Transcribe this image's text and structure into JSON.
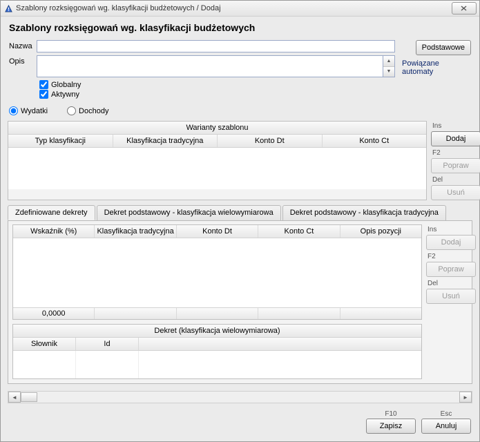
{
  "window": {
    "title": "Szablony rozksięgowań wg. klasyfikacji budżetowych / Dodaj"
  },
  "header": {
    "title": "Szablony rozksięgowań wg. klasyfikacji budżetowych"
  },
  "form": {
    "name_label": "Nazwa",
    "name_value": "",
    "desc_label": "Opis",
    "desc_value": "",
    "btn_basic": "Podstawowe",
    "link_related": "Powiązane automaty",
    "chk_global": "Globalny",
    "chk_active": "Aktywny"
  },
  "radio": {
    "expenses": "Wydatki",
    "incomes": "Dochody"
  },
  "variants": {
    "caption": "Warianty szablonu",
    "cols": {
      "c1": "Typ klasyfikacji",
      "c2": "Klasyfikacja tradycyjna",
      "c3": "Konto Dt",
      "c4": "Konto Ct"
    }
  },
  "side": {
    "ins": "Ins",
    "add": "Dodaj",
    "f2": "F2",
    "edit": "Popraw",
    "del": "Del",
    "remove": "Usuń"
  },
  "tabs": {
    "t1": "Zdefiniowane dekrety",
    "t2": "Dekret podstawowy - klasyfikacja wielowymiarowa",
    "t3": "Dekret podstawowy - klasyfikacja tradycyjna"
  },
  "decrees": {
    "cols": {
      "c1": "Wskaźnik (%)",
      "c2": "Klasyfikacja tradycyjna",
      "c3": "Konto Dt",
      "c4": "Konto Ct",
      "c5": "Opis pozycji"
    },
    "footer_c1": "0,0000"
  },
  "mdim": {
    "caption": "Dekret (klasyfikacja wielowymiarowa)",
    "cols": {
      "c1": "Słownik",
      "c2": "Id"
    }
  },
  "actions": {
    "f10": "F10",
    "save": "Zapisz",
    "esc": "Esc",
    "cancel": "Anuluj"
  }
}
